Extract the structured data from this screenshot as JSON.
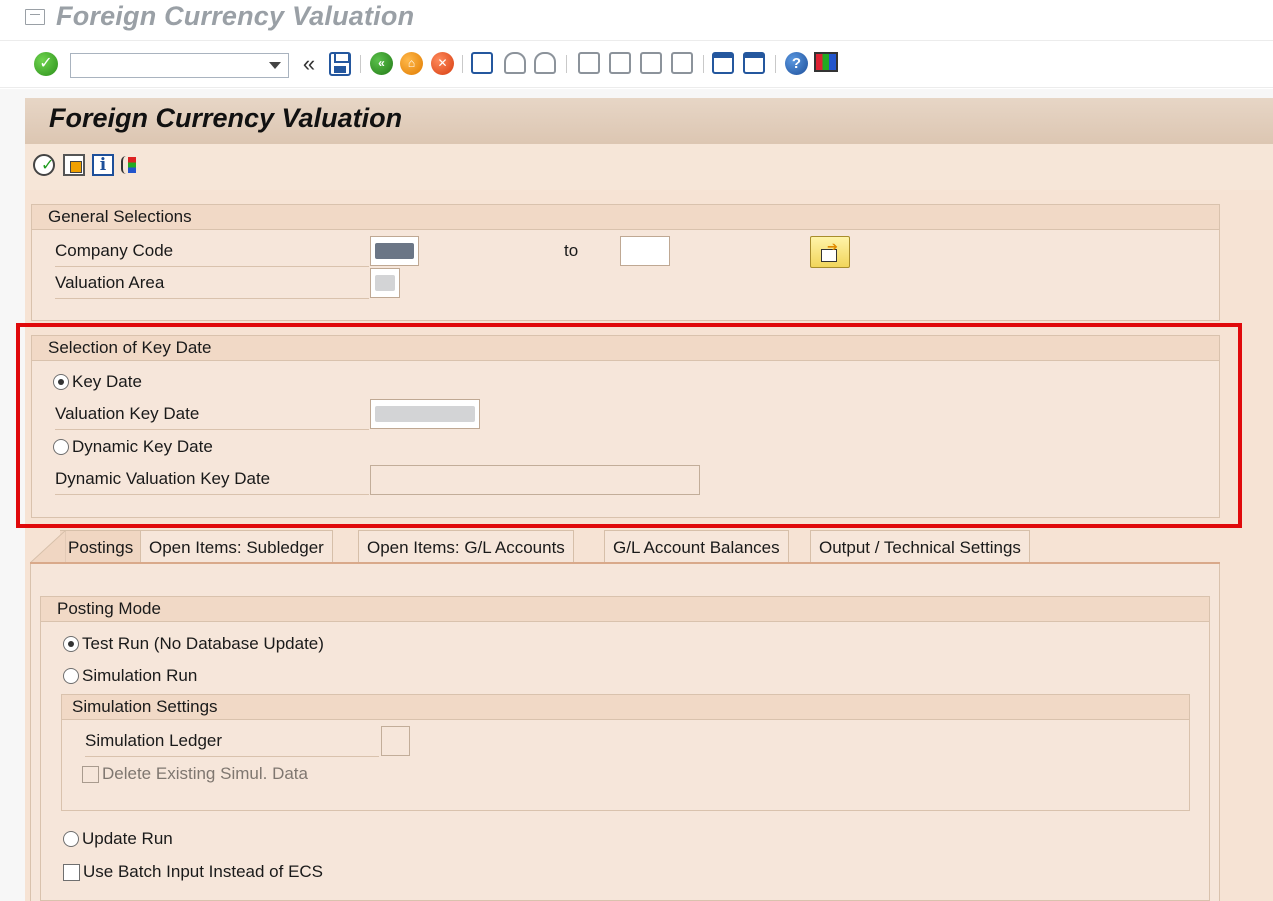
{
  "window": {
    "title": "Foreign Currency Valuation"
  },
  "toolbar": {
    "command_field": {
      "value": "",
      "placeholder": ""
    },
    "collapse_label": "«"
  },
  "main": {
    "title": "Foreign Currency Valuation"
  },
  "general_selections": {
    "title": "General Selections",
    "company_code_label": "Company Code",
    "to_label": "to",
    "valuation_area_label": "Valuation Area"
  },
  "key_date_selection": {
    "title": "Selection of Key Date",
    "key_date_radio": "Key Date",
    "valuation_key_date_label": "Valuation Key Date",
    "dynamic_key_date_radio": "Dynamic Key Date",
    "dynamic_valuation_key_date_label": "Dynamic Valuation Key Date"
  },
  "tabs": [
    {
      "label": "Postings"
    },
    {
      "label": "Open Items: Subledger"
    },
    {
      "label": "Open Items: G/L Accounts"
    },
    {
      "label": "G/L Account Balances"
    },
    {
      "label": "Output / Technical Settings"
    }
  ],
  "posting_mode": {
    "title": "Posting Mode",
    "test_run": "Test Run (No Database Update)",
    "simulation_run": "Simulation Run",
    "simulation_settings": {
      "title": "Simulation Settings",
      "simulation_ledger_label": "Simulation Ledger",
      "delete_existing": "Delete Existing Simul. Data"
    },
    "update_run": "Update Run",
    "batch_input": "Use Batch Input Instead of ECS"
  },
  "colors": {
    "highlight": "#e0090b",
    "header_band": "#dcc6b2",
    "panel": "#f6e6da"
  }
}
